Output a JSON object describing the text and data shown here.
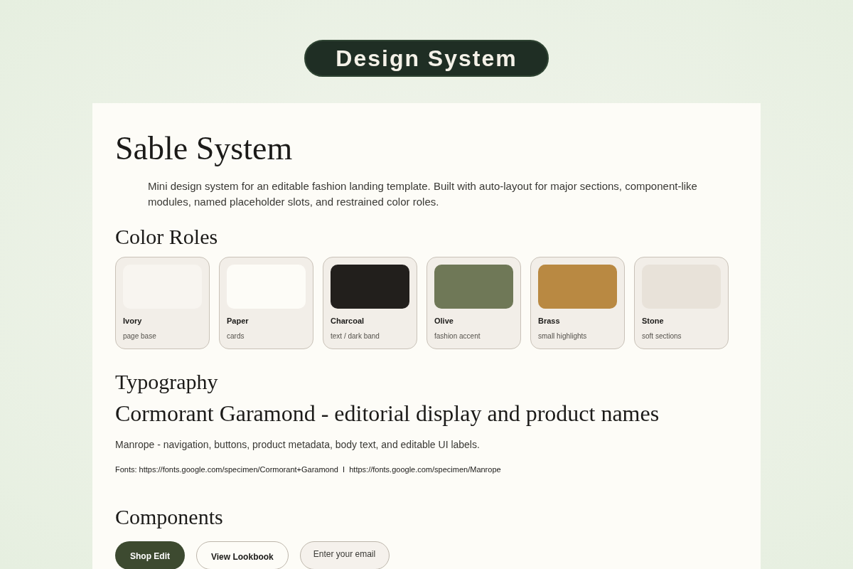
{
  "badge": "Design System",
  "title": "Sable System",
  "description": "Mini design system for an editable fashion landing template. Built with auto-layout for major sections, component-like modules, named placeholder slots, and restrained color roles.",
  "color_roles": {
    "heading": "Color Roles",
    "swatches": [
      {
        "name": "Ivory",
        "role": "page base",
        "color": "#f8f5f0"
      },
      {
        "name": "Paper",
        "role": "cards",
        "color": "#fdfcf7"
      },
      {
        "name": "Charcoal",
        "role": "text / dark band",
        "color": "#221f1c"
      },
      {
        "name": "Olive",
        "role": "fashion accent",
        "color": "#6f7857"
      },
      {
        "name": "Brass",
        "role": "small highlights",
        "color": "#b98942"
      },
      {
        "name": "Stone",
        "role": "soft sections",
        "color": "#e8e2d9"
      }
    ]
  },
  "typography": {
    "heading": "Typography",
    "display_sample": "Cormorant Garamond - editorial display and product names",
    "body_sample": "Manrope - navigation, buttons, product metadata, body text, and editable UI labels.",
    "fonts_line": "Fonts: https://fonts.google.com/specimen/Cormorant+Garamond  I  https://fonts.google.com/specimen/Manrope"
  },
  "components": {
    "heading": "Components",
    "items": [
      {
        "kind": "primary",
        "label": "Shop Edit"
      },
      {
        "kind": "secondary",
        "label": "View Lookbook"
      },
      {
        "kind": "input",
        "placeholder": "Enter your email"
      }
    ]
  }
}
